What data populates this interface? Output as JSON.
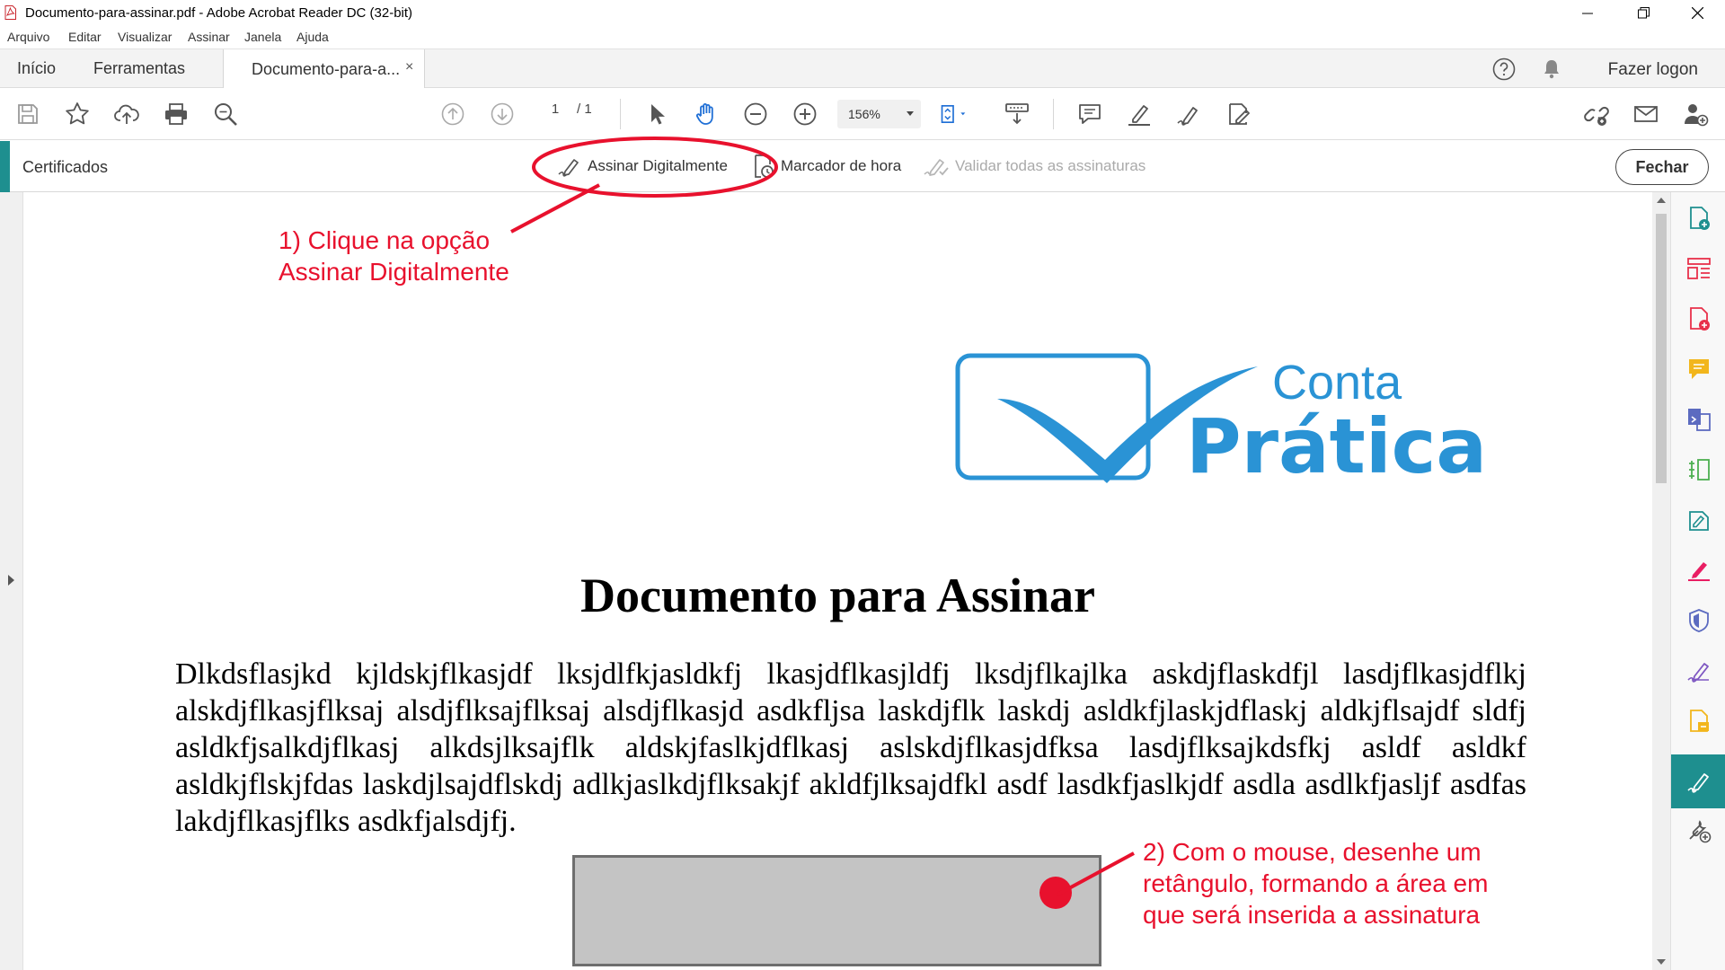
{
  "window": {
    "title": "Documento-para-assinar.pdf - Adobe Acrobat Reader DC (32-bit)"
  },
  "menu": [
    "Arquivo",
    "Editar",
    "Visualizar",
    "Assinar",
    "Janela",
    "Ajuda"
  ],
  "tabs": {
    "home": "Início",
    "tools": "Ferramentas",
    "document": "Documento-para-a...",
    "close_symbol": "×"
  },
  "account": {
    "logon": "Fazer logon"
  },
  "toolbar": {
    "page_current": "1",
    "page_total": "/ 1",
    "zoom": "156%"
  },
  "certificates": {
    "title": "Certificados",
    "sign_digitally": "Assinar Digitalmente",
    "timestamp": "Marcador de hora",
    "validate_all": "Validar todas as assinaturas",
    "close": "Fechar"
  },
  "document": {
    "logo_line1": "Conta",
    "logo_line2": "Prática",
    "heading": "Documento para Assinar",
    "body": "Dlkdsflasjkd kjldskjflkasjdf lksjdlfkjasldkfj lkasjdflkasjldfj lksdjflkajlka askdjflaskdfjl lasdjflkasjdflkj alskdjflkasjflksaj alsdjflksajflksaj alsdjflkasjd asdkfljsa laskdjflk laskdj asldkfjlaskjdflaskj aldkjflsajdf sldfj asldkfjsalkdjflkasj alkdsjlksajflk aldskjfaslkjdflkasj aslskdjflkasjdfksa lasdjflksajkdsfkj asldf asldkf asldkjflskjfdas laskdjlsajdflskdj adlkjaslkdjflksakjf akldfjlksajdfkl asdf lasdkfjaslkjdf asdla asdlkfjasljf asdfas lakdjflkasjflks asdkfjalsdjfj."
  },
  "annotations": {
    "step1_line1": "1) Clique na opção",
    "step1_line2": "Assinar Digitalmente",
    "step2_line1": "2) Com o mouse, desenhe um",
    "step2_line2": "retângulo, formando a área em",
    "step2_line3": "que será inserida a assinatura"
  },
  "colors": {
    "accent": "#1e8f8f",
    "annotation_red": "#e8112d",
    "logo_blue": "#2a93d5"
  }
}
